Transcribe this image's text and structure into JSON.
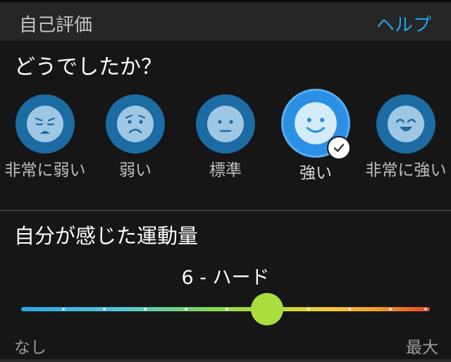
{
  "header": {
    "title": "自己評価",
    "help_label": "ヘルプ"
  },
  "question": "どうでしたか？",
  "feelings": [
    {
      "label": "非常に弱い",
      "face": "very-weak"
    },
    {
      "label": "弱い",
      "face": "weak"
    },
    {
      "label": "標準",
      "face": "normal"
    },
    {
      "label": "強い",
      "face": "strong",
      "selected": true
    },
    {
      "label": "非常に強い",
      "face": "very-strong"
    }
  ],
  "effort": {
    "title": "自分が感じた運動量",
    "value_label": "6 - ハード",
    "value": 6,
    "min_label": "なし",
    "max_label": "最大"
  },
  "colors": {
    "accent": "#21a3e6",
    "circle_dark": "#1c6ba3",
    "circle_selected": "#2b8fe3",
    "thumb": "#a9de3f"
  }
}
